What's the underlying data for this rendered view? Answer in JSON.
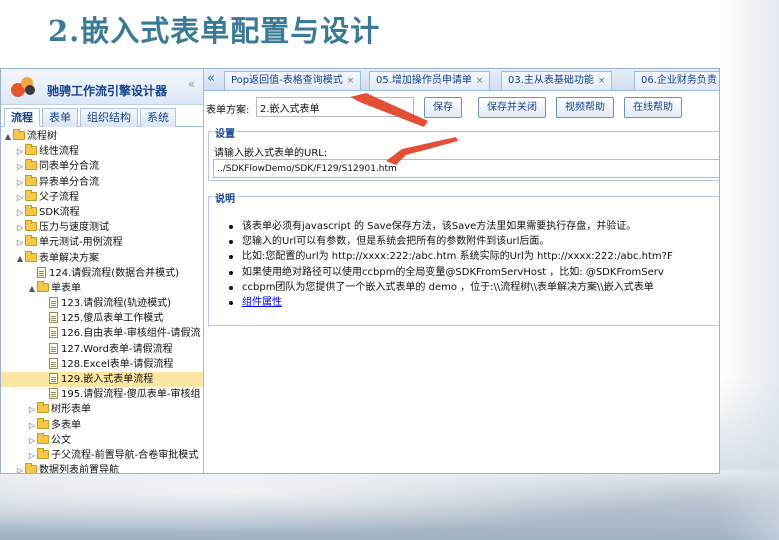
{
  "slide": {
    "title": "2.嵌入式表单配置与设计"
  },
  "left": {
    "app_title": "驰骋工作流引擎设计器",
    "collapse_icon": "double-chevron-left-icon",
    "tabs": [
      "流程",
      "表单",
      "组织结构",
      "系统"
    ],
    "tree": [
      {
        "label": "流程树",
        "level": 0,
        "toggle": "▲",
        "icon": "folder",
        "selected": false
      },
      {
        "label": "线性流程",
        "level": 1,
        "toggle": "▷",
        "icon": "folder",
        "selected": false
      },
      {
        "label": "同表单分合流",
        "level": 1,
        "toggle": "▷",
        "icon": "folder",
        "selected": false
      },
      {
        "label": "异表单分合流",
        "level": 1,
        "toggle": "▷",
        "icon": "folder",
        "selected": false
      },
      {
        "label": "父子流程",
        "level": 1,
        "toggle": "▷",
        "icon": "folder",
        "selected": false
      },
      {
        "label": "SDK流程",
        "level": 1,
        "toggle": "▷",
        "icon": "folder",
        "selected": false
      },
      {
        "label": "压力与速度测试",
        "level": 1,
        "toggle": "▷",
        "icon": "folder",
        "selected": false
      },
      {
        "label": "单元测试-用例流程",
        "level": 1,
        "toggle": "▷",
        "icon": "folder",
        "selected": false
      },
      {
        "label": "表单解决方案",
        "level": 1,
        "toggle": "▲",
        "icon": "folder",
        "selected": false
      },
      {
        "label": "124.请假流程(数据合并模式)",
        "level": 2,
        "toggle": "",
        "icon": "file",
        "selected": false
      },
      {
        "label": "单表单",
        "level": 2,
        "toggle": "▲",
        "icon": "folder",
        "selected": false
      },
      {
        "label": "123.请假流程(轨迹模式)",
        "level": 3,
        "toggle": "",
        "icon": "file",
        "selected": false
      },
      {
        "label": "125.傻瓜表单工作模式",
        "level": 3,
        "toggle": "",
        "icon": "file",
        "selected": false
      },
      {
        "label": "126.自由表单-审核组件-请假流",
        "level": 3,
        "toggle": "",
        "icon": "file",
        "selected": false
      },
      {
        "label": "127.Word表单-请假流程",
        "level": 3,
        "toggle": "",
        "icon": "file",
        "selected": false
      },
      {
        "label": "128.Excel表单-请假流程",
        "level": 3,
        "toggle": "",
        "icon": "file",
        "selected": false
      },
      {
        "label": "129.嵌入式表单流程",
        "level": 3,
        "toggle": "",
        "icon": "file",
        "selected": true
      },
      {
        "label": "195.请假流程-傻瓜表单-审核组",
        "level": 3,
        "toggle": "",
        "icon": "file",
        "selected": false
      },
      {
        "label": "树形表单",
        "level": 2,
        "toggle": "▷",
        "icon": "folder",
        "selected": false
      },
      {
        "label": "多表单",
        "level": 2,
        "toggle": "▷",
        "icon": "folder",
        "selected": false
      },
      {
        "label": "公文",
        "level": 2,
        "toggle": "▷",
        "icon": "folder",
        "selected": false
      },
      {
        "label": "子父流程-前置导航-合卷审批模式",
        "level": 2,
        "toggle": "▷",
        "icon": "folder",
        "selected": false
      },
      {
        "label": "数据列表前置导航",
        "level": 1,
        "toggle": "▷",
        "icon": "folder",
        "selected": false
      }
    ]
  },
  "tabs": [
    {
      "label": "Pop返回值-表格查询模式",
      "close": "×"
    },
    {
      "label": "05.增加操作员申请单",
      "close": "×"
    },
    {
      "label": "03.主从表基础功能",
      "close": "×"
    },
    {
      "label": "06.企业财务负责",
      "close": ""
    }
  ],
  "tabbar_scroll_icon": "double-chevron-left-icon",
  "toolbar": {
    "label": "表单方案:",
    "scheme_value": "2.嵌入式表单",
    "buttons": [
      "保存",
      "保存并关闭",
      "视频帮助",
      "在线帮助"
    ]
  },
  "settings": {
    "legend": "设置",
    "prompt": "请输入嵌入式表单的URL:",
    "url_value": "../SDKFlowDemo/SDK/F129/S12901.htm"
  },
  "notes": {
    "legend": "说明",
    "items": [
      "该表单必须有javascript 的 Save保存方法，该Save方法里如果需要执行存盘，并验证。",
      "您输入的Url可以有参数，但是系统会把所有的参数附件到该url后面。",
      "比如:您配置的url为 http://xxxx:222:/abc.htm 系统实际的Url为 http://xxxx:222:/abc.htm?F",
      "如果使用绝对路径可以使用ccbpm的全局变量@SDKFromServHost ，比如: @SDKFromServ",
      "ccbpm团队为您提供了一个嵌入式表单的 demo ，位于:\\\\流程树\\\\表单解决方案\\\\嵌入式表单"
    ],
    "link": "组件属性"
  },
  "colors": {
    "title": "#3a7a94",
    "arrow": "#e4452b",
    "selected_row": "#fbe6a3",
    "panel_border": "#99bbe8"
  }
}
